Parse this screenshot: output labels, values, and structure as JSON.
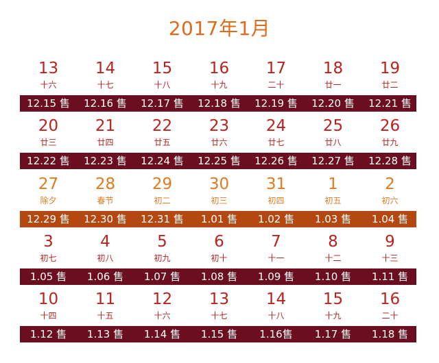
{
  "title": "2017年1月",
  "colors": {
    "title": "#e06a1c",
    "date_red": "#b8231e",
    "date_orange": "#e07a1e",
    "bar_maroon": "#6b0f20",
    "bar_orange": "#b44810"
  },
  "weeks": [
    {
      "accent": "maroon",
      "days": [
        {
          "num": "13",
          "lunar": "十六",
          "sale": "12.15 售",
          "tone": "red"
        },
        {
          "num": "14",
          "lunar": "十七",
          "sale": "12.16 售",
          "tone": "red"
        },
        {
          "num": "15",
          "lunar": "十八",
          "sale": "12.17 售",
          "tone": "red"
        },
        {
          "num": "16",
          "lunar": "十九",
          "sale": "12.18 售",
          "tone": "red"
        },
        {
          "num": "17",
          "lunar": "二十",
          "sale": "12.19 售",
          "tone": "red"
        },
        {
          "num": "18",
          "lunar": "廿一",
          "sale": "12.20 售",
          "tone": "red"
        },
        {
          "num": "19",
          "lunar": "廿二",
          "sale": "12.21 售",
          "tone": "red"
        }
      ]
    },
    {
      "accent": "maroon",
      "days": [
        {
          "num": "20",
          "lunar": "廿三",
          "sale": "12.22 售",
          "tone": "red"
        },
        {
          "num": "21",
          "lunar": "廿四",
          "sale": "12.23 售",
          "tone": "red"
        },
        {
          "num": "22",
          "lunar": "廿五",
          "sale": "12.24 售",
          "tone": "red"
        },
        {
          "num": "23",
          "lunar": "廿六",
          "sale": "12.25 售",
          "tone": "red"
        },
        {
          "num": "24",
          "lunar": "廿七",
          "sale": "12.26 售",
          "tone": "red"
        },
        {
          "num": "25",
          "lunar": "廿八",
          "sale": "12.27 售",
          "tone": "red"
        },
        {
          "num": "26",
          "lunar": "廿九",
          "sale": "12.28 售",
          "tone": "red"
        }
      ]
    },
    {
      "accent": "orange",
      "days": [
        {
          "num": "27",
          "lunar": "除夕",
          "sale": "12.29 售",
          "tone": "orange"
        },
        {
          "num": "28",
          "lunar": "春节",
          "sale": "12.30 售",
          "tone": "orange"
        },
        {
          "num": "29",
          "lunar": "初二",
          "sale": "12.31 售",
          "tone": "orange"
        },
        {
          "num": "30",
          "lunar": "初三",
          "sale": "1.01 售",
          "tone": "orange"
        },
        {
          "num": "31",
          "lunar": "初四",
          "sale": "1.02 售",
          "tone": "orange"
        },
        {
          "num": "1",
          "lunar": "初五",
          "sale": "1.03 售",
          "tone": "orange"
        },
        {
          "num": "2",
          "lunar": "初六",
          "sale": "1.04 售",
          "tone": "orange"
        }
      ]
    },
    {
      "accent": "maroon",
      "days": [
        {
          "num": "3",
          "lunar": "初七",
          "sale": "1.05 售",
          "tone": "red"
        },
        {
          "num": "4",
          "lunar": "初八",
          "sale": "1.06 售",
          "tone": "red"
        },
        {
          "num": "5",
          "lunar": "初九",
          "sale": "1.07 售",
          "tone": "red"
        },
        {
          "num": "6",
          "lunar": "初十",
          "sale": "1.08 售",
          "tone": "red"
        },
        {
          "num": "7",
          "lunar": "十一",
          "sale": "1.09 售",
          "tone": "red"
        },
        {
          "num": "8",
          "lunar": "十二",
          "sale": "1.10 售",
          "tone": "red"
        },
        {
          "num": "9",
          "lunar": "十三",
          "sale": "1.11 售",
          "tone": "red"
        }
      ]
    },
    {
      "accent": "maroon",
      "days": [
        {
          "num": "10",
          "lunar": "十四",
          "sale": "1.12 售",
          "tone": "red"
        },
        {
          "num": "11",
          "lunar": "十五",
          "sale": "1.13 售",
          "tone": "red"
        },
        {
          "num": "12",
          "lunar": "十六",
          "sale": "1.14 售",
          "tone": "red"
        },
        {
          "num": "13",
          "lunar": "十七",
          "sale": "1.15 售",
          "tone": "red"
        },
        {
          "num": "14",
          "lunar": "十八",
          "sale": "1.16售",
          "tone": "red"
        },
        {
          "num": "15",
          "lunar": "十九",
          "sale": "1.17 售",
          "tone": "red"
        },
        {
          "num": "16",
          "lunar": "二十",
          "sale": "1.18 售",
          "tone": "red"
        }
      ]
    }
  ]
}
